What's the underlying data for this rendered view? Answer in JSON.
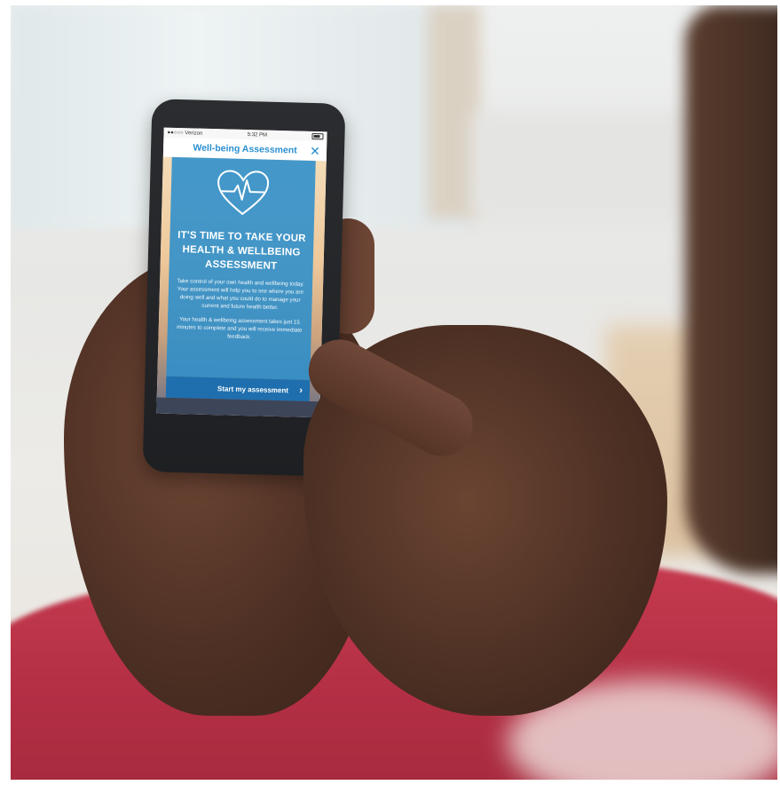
{
  "status_bar": {
    "carrier": "●●○○○ Verizon",
    "time": "5:32 PM"
  },
  "header": {
    "title": "Well-being Assessment",
    "close_icon": "close-icon"
  },
  "card": {
    "icon": "heart-pulse-icon",
    "headline": "IT'S TIME TO TAKE YOUR HEALTH & WELLBEING ASSESSMENT",
    "paragraph_1": "Take control of your own health and wellbeing today. Your assessment will help you to see where you are doing well and what you could do to manage your current and future health better.",
    "paragraph_2": "Your health & wellbeing assessment takes just 15 minutes to complete and you will receive immediate feedback."
  },
  "cta": {
    "label": "Start my assessment",
    "icon": "chevron-right-icon"
  },
  "colors": {
    "accent": "#2a8fd0",
    "card_background": "#2b8ecc",
    "cta_background": "#1f6fae"
  }
}
